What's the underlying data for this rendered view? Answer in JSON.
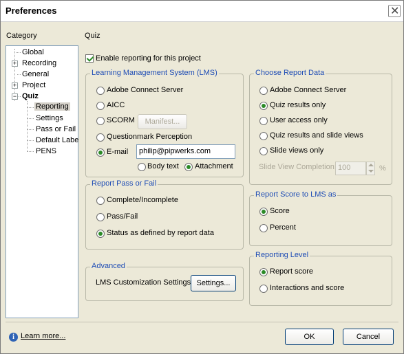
{
  "window": {
    "title": "Preferences"
  },
  "category_label": "Category",
  "page_title": "Quiz",
  "tree": {
    "items": [
      "Global",
      "Recording",
      "General",
      "Project",
      "Quiz"
    ],
    "quiz_children": [
      "Reporting",
      "Settings",
      "Pass or Fail",
      "Default Labe",
      "PENS"
    ]
  },
  "enable_reporting": "Enable reporting for this project",
  "lms": {
    "title": "Learning Management System (LMS)",
    "options": [
      "Adobe Connect Server",
      "AICC",
      "SCORM",
      "Questionmark Perception",
      "E-mail"
    ],
    "manifest_button": "Manifest...",
    "email_value": "philip@pipwerks.com",
    "body_text": "Body text",
    "attachment": "Attachment"
  },
  "report_pass": {
    "title": "Report Pass or Fail",
    "options": [
      "Complete/Incomplete",
      "Pass/Fail",
      "Status as defined by report data"
    ]
  },
  "advanced": {
    "title": "Advanced",
    "label": "LMS Customization Settings",
    "button": "Settings..."
  },
  "report_data": {
    "title": "Choose Report Data",
    "options": [
      "Adobe Connect Server",
      "Quiz results only",
      "User access only",
      "Quiz results and slide views",
      "Slide views only"
    ],
    "completion_label": "Slide View Completion:",
    "completion_value": "100",
    "percent": "%"
  },
  "report_score": {
    "title": "Report Score to LMS as",
    "options": [
      "Score",
      "Percent"
    ]
  },
  "reporting_level": {
    "title": "Reporting Level",
    "options": [
      "Report score",
      "Interactions and score"
    ]
  },
  "footer": {
    "learn_more": "Learn more...",
    "ok": "OK",
    "cancel": "Cancel"
  }
}
